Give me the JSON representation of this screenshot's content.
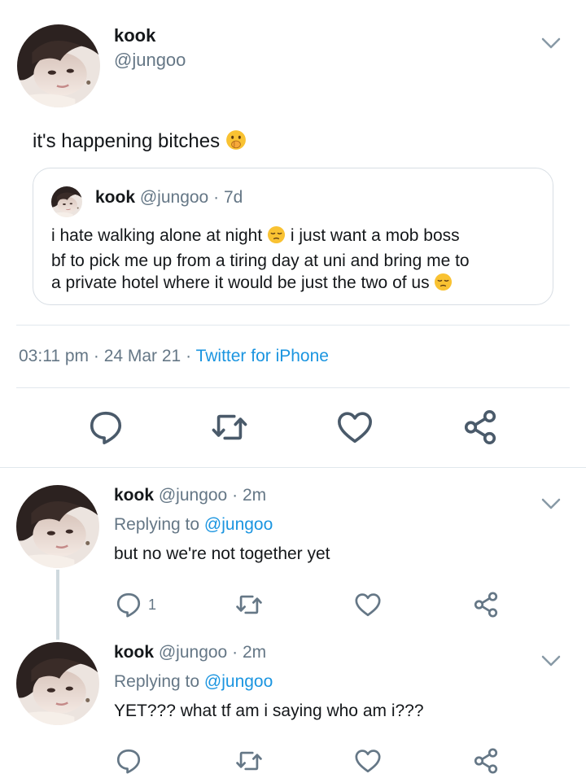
{
  "main_tweet": {
    "display_name": "kook",
    "handle": "@jungoo",
    "text": "it's happening bitches",
    "text_emoji": "shushing-face-emoji",
    "quoted": {
      "display_name": "kook",
      "handle": "@jungoo",
      "age": "7d",
      "line1": "i hate walking alone at night",
      "line1b": "i just want a mob boss",
      "line2": "bf to pick me up from a tiring day at uni and bring me to",
      "line3": "a private hotel where it would be just the two of us",
      "emoji": "pensive-face-emoji"
    },
    "time": "03:11 pm",
    "date": "24 Mar 21",
    "source": "Twitter for iPhone"
  },
  "replies": [
    {
      "display_name": "kook",
      "handle": "@jungoo",
      "age": "2m",
      "replying_label": "Replying to",
      "replying_to": "@jungoo",
      "text": "but no we're not together yet",
      "reply_count": "1"
    },
    {
      "display_name": "kook",
      "handle": "@jungoo",
      "age": "2m",
      "replying_label": "Replying to",
      "replying_to": "@jungoo",
      "text": "YET??? what tf am i saying who am i???",
      "reply_count": ""
    }
  ],
  "separator": "·",
  "colors": {
    "text": "#14171a",
    "secondary": "#657786",
    "link": "#1b95e0",
    "divider": "#e1e8ed",
    "icon": "#657786",
    "icon_large": "#4a5a6a"
  },
  "icons": [
    "chevron-down-icon",
    "reply-icon",
    "retweet-icon",
    "like-icon",
    "share-icon"
  ]
}
